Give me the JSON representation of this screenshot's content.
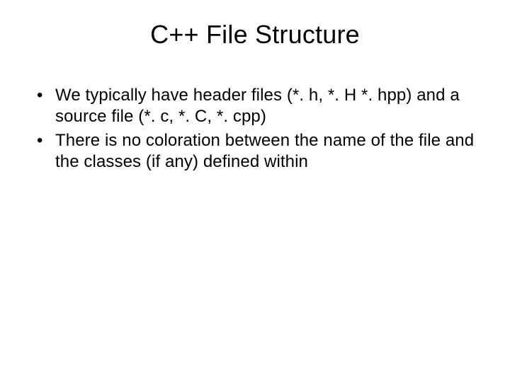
{
  "slide": {
    "title": "C++ File Structure",
    "bullets": [
      "We typically have header files (*. h, *. H *. hpp) and a source file (*. c, *. C, *. cpp)",
      "There is no coloration between the name of the file and the classes (if any) defined within"
    ]
  }
}
